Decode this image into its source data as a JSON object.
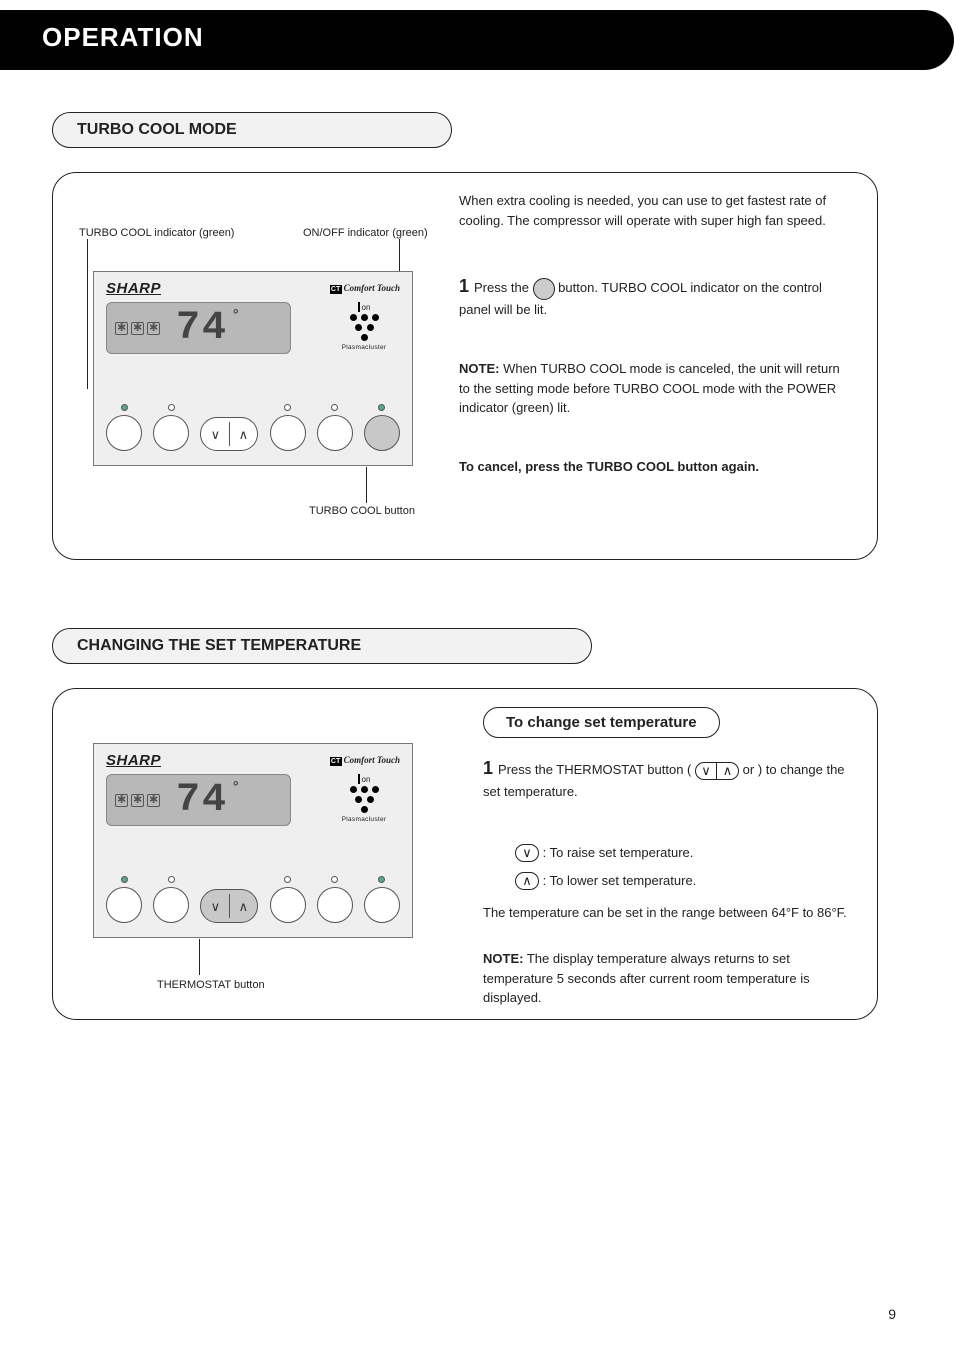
{
  "header": {
    "title": "OPERATION"
  },
  "page_number": "9",
  "panel": {
    "brand": "SHARP",
    "comfort_badge": "CT",
    "comfort_text": "Comfort Touch",
    "lcd_temp": "74",
    "ion_label": "on",
    "plasma_label": "Plasmacluster"
  },
  "section1": {
    "title": "TURBO COOL MODE",
    "body1": "When extra cooling is needed, you can use to get fastest rate of cooling. The compressor will operate with super high fan speed.",
    "body2_a": "Press the ",
    "body2_b": " button. TURBO COOL indicator on the control panel will be lit.",
    "callout_a": "TURBO COOL indicator (green)",
    "callout_b": "ON/OFF indicator (green)",
    "callout_c": "TURBO COOL button",
    "note_heading": "NOTE:",
    "note_body": "When TURBO COOL mode is canceled, the unit will return to the setting mode before TURBO COOL mode with the POWER indicator (green) lit.",
    "cancel": "To cancel, press the TURBO COOL button again."
  },
  "section2": {
    "title": "CHANGING THE SET TEMPERATURE",
    "inner_title": "To change set temperature",
    "body1_a": "Press the THERMOSTAT button (",
    "body1_b": " or ",
    "body1_c": ") to change the set temperature.",
    "bullet1_icon": "∨",
    "bullet1_text": " : To raise set temperature.",
    "bullet2_icon": "∧",
    "bullet2_text": " : To lower set temperature.",
    "range_a": "The temperature can be set in the range ",
    "range_b": " between 64°F to 86°F.",
    "callout": "THERMOSTAT button",
    "note_heading": "NOTE:",
    "note_body": "The display temperature always returns to set temperature 5 seconds after current room temperature is displayed."
  }
}
